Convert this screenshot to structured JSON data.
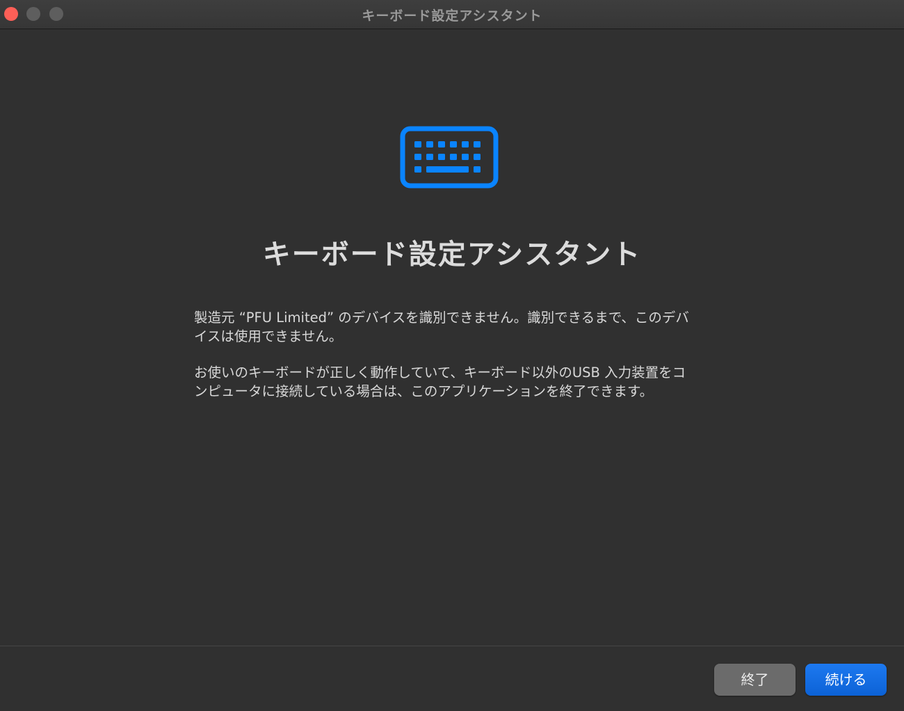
{
  "window": {
    "title": "キーボード設定アシスタント"
  },
  "main": {
    "icon": "keyboard-icon",
    "accent_color": "#0a84ff",
    "heading": "キーボード設定アシスタント",
    "paragraph_1": "製造元 “PFU Limited” のデバイスを識別できません。識別できるまで、このデバイスは使用できません。",
    "paragraph_2": "お使いのキーボードが正しく動作していて、キーボード以外のUSB 入力装置をコンピュータに接続している場合は、このアプリケーションを終了できます。"
  },
  "footer": {
    "quit_label": "終了",
    "continue_label": "続ける"
  }
}
